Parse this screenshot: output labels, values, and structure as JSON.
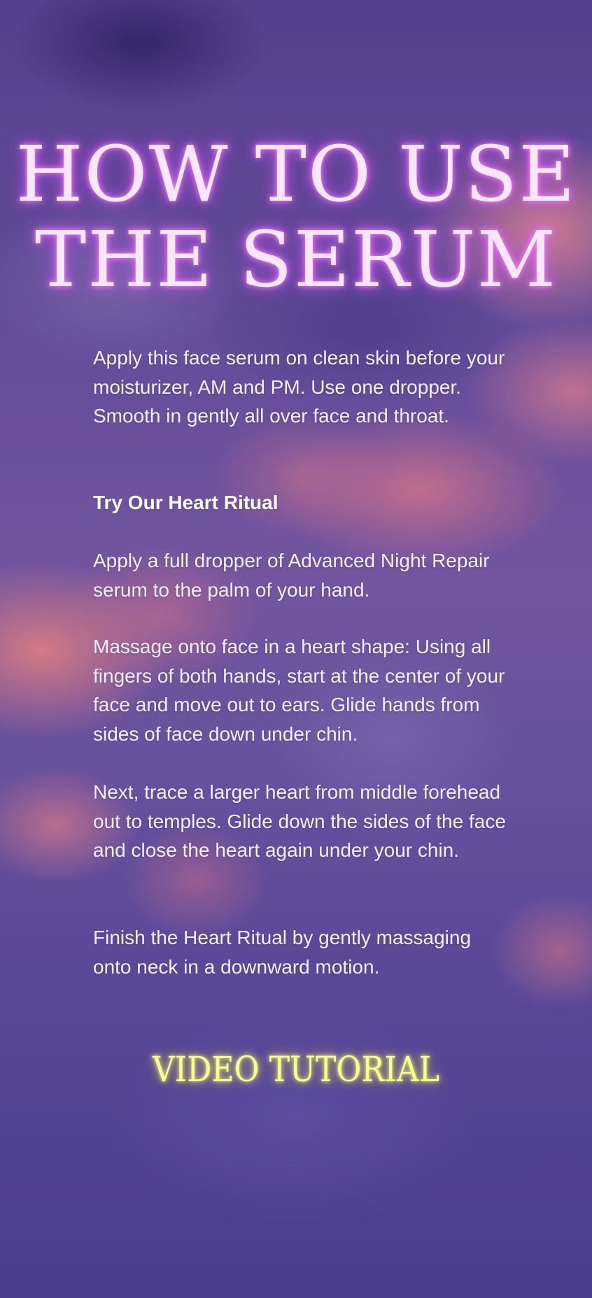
{
  "heading": {
    "line1": "HOW TO USE",
    "line2": "THE SERUM"
  },
  "instructions": {
    "intro": "Apply this face serum on clean skin before your moisturizer, AM and PM. Use one dropper. Smooth in gently all over face and throat.",
    "ritual_title": "Try Our Heart Ritual",
    "steps": [
      "Apply a full dropper of Advanced Night Repair serum to the palm of your hand.",
      "Massage onto face in a heart shape: Using all fingers of both hands, start at the center of your face and move out to ears. Glide hands from sides of face down under chin.",
      "Next, trace a larger heart from middle forehead out to temples. Glide down the sides of the face and close the heart again under your chin.",
      "Finish the Heart Ritual by gently massaging onto neck in a downward motion."
    ]
  },
  "video": {
    "label": "VIDEO TUTORIAL"
  },
  "colors": {
    "heading": "#fbe6ff",
    "heading_glow": "#e65aff",
    "body_text": "#f6f0ff",
    "video_link": "#f9ff8f",
    "sky_base": "#5a4290",
    "cloud_pink": "#fa8c82"
  }
}
